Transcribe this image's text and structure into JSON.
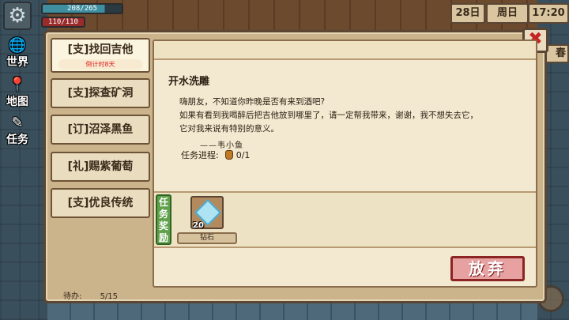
{
  "hud": {
    "hp_text": "208/265",
    "hp_fraction": 0.785,
    "mp_text": "110/110",
    "mp_fraction": 1.0,
    "date_day": "28日",
    "date_week": "周日",
    "time": "17:20",
    "right_edge_label": "春"
  },
  "side_nav": {
    "world": "世界",
    "map": "地图",
    "task": "任务"
  },
  "quests": [
    {
      "label": "[支]找回吉他",
      "countdown": "倒计时8天"
    },
    {
      "label": "[支]探查矿洞"
    },
    {
      "label": "[订]沼泽黑鱼"
    },
    {
      "label": "[礼]赐紫葡萄"
    },
    {
      "label": "[支]优良传统"
    }
  ],
  "pending": {
    "label": "待办:",
    "value": "5/15"
  },
  "detail": {
    "title": "开水洗雕",
    "description": [
      "嗨朋友，不知道你昨晚是否有来到酒吧?",
      "如果有看到我喝醉后把吉他放到哪里了，请一定帮我带来，谢谢，我不想失去它，",
      "它对我来说有特别的意义。"
    ],
    "npc": "——韦小鱼",
    "progress_label": "任务进程:",
    "progress_value": "0/1",
    "reward_tag": "任务奖励",
    "reward": {
      "name": "钻石",
      "qty": "20"
    },
    "abandon_label": "放弃"
  },
  "colors": {
    "panel_bg": "#cbb48c",
    "accent_red": "#c62424",
    "reward_green": "#5fa04a",
    "hp_bar": "#3f8fa0",
    "mp_bar": "#9a2b2b"
  }
}
